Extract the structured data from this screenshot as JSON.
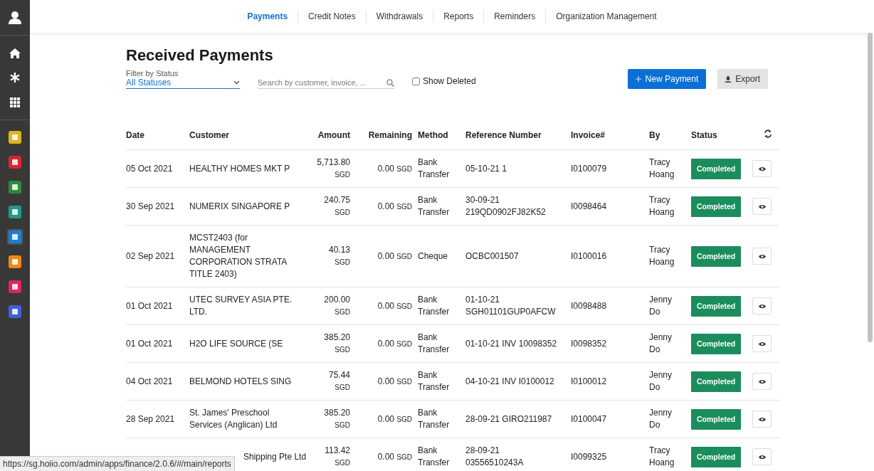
{
  "sidebar": {
    "items": [
      {
        "kind": "user"
      },
      {
        "kind": "home"
      },
      {
        "kind": "asterisk"
      },
      {
        "kind": "grid"
      },
      {
        "kind": "app",
        "color": "#e2b422",
        "selected": false
      },
      {
        "kind": "app",
        "color": "#d8262c",
        "selected": false
      },
      {
        "kind": "app",
        "color": "#2e8b3a",
        "selected": false
      },
      {
        "kind": "app",
        "color": "#1f9a8a",
        "selected": false
      },
      {
        "kind": "app",
        "color": "#1b7fd6",
        "selected": true
      },
      {
        "kind": "app",
        "color": "#ea8a14",
        "selected": false
      },
      {
        "kind": "app",
        "color": "#e0245e",
        "selected": false
      },
      {
        "kind": "app",
        "color": "#3d5fd8",
        "selected": false
      }
    ]
  },
  "tabs": [
    {
      "label": "Payments",
      "selected": true
    },
    {
      "label": "Credit Notes",
      "selected": false
    },
    {
      "label": "Withdrawals",
      "selected": false
    },
    {
      "label": "Reports",
      "selected": false
    },
    {
      "label": "Reminders",
      "selected": false
    },
    {
      "label": "Organization Management",
      "selected": false
    }
  ],
  "page_title": "Received Payments",
  "filter": {
    "label": "Filter by Status",
    "value": "All Statuses"
  },
  "search": {
    "placeholder": "Search by customer, invoice, ..."
  },
  "show_deleted": {
    "label": "Show Deleted",
    "checked": false
  },
  "buttons": [
    {
      "kind": "primary",
      "label": "New Payment"
    },
    {
      "kind": "export",
      "label": "Export"
    }
  ],
  "table": {
    "columns": [
      "Date",
      "Customer",
      "Amount",
      "Remaining",
      "Method",
      "Reference Number",
      "Invoice#",
      "By",
      "Status"
    ],
    "rows": [
      {
        "date": "05 Oct 2021",
        "customer": "HEALTHY HOMES MKT P",
        "amount": "5,713.80",
        "amount_currency": "SGD",
        "remaining": "0.00",
        "remaining_currency": "SGD",
        "method": "Bank Transfer",
        "reference": "05-10-21 1",
        "invoice": "I0100079",
        "by": "Tracy Hoang",
        "status": "Completed"
      },
      {
        "date": "30 Sep 2021",
        "customer": "NUMERIX SINGAPORE P",
        "amount": "240.75",
        "amount_currency": "SGD",
        "remaining": "0.00",
        "remaining_currency": "SGD",
        "method": "Bank Transfer",
        "reference": "30-09-21 219QD0902FJ82K52",
        "invoice": "I0098464",
        "by": "Tracy Hoang",
        "status": "Completed"
      },
      {
        "date": "02 Sep 2021",
        "customer": "MCST2403 (for MANAGEMENT CORPORATION STRATA TITLE 2403)",
        "amount": "40.13",
        "amount_currency": "SGD",
        "remaining": "0.00",
        "remaining_currency": "SGD",
        "method": "Cheque",
        "reference": "OCBC001507",
        "invoice": "I0100016",
        "by": "Tracy Hoang",
        "status": "Completed"
      },
      {
        "date": "01 Oct 2021",
        "customer": "UTEC SURVEY ASIA PTE. LTD.",
        "amount": "200.00",
        "amount_currency": "SGD",
        "remaining": "0.00",
        "remaining_currency": "SGD",
        "method": "Bank Transfer",
        "reference": "01-10-21 SGH01101GUP0AFCW",
        "invoice": "I0098488",
        "by": "Jenny Do",
        "status": "Completed"
      },
      {
        "date": "01 Oct 2021",
        "customer": "H2O LIFE SOURCE (SE",
        "amount": "385.20",
        "amount_currency": "SGD",
        "remaining": "0.00",
        "remaining_currency": "SGD",
        "method": "Bank Transfer",
        "reference": "01-10-21 INV 10098352",
        "invoice": "I0098352",
        "by": "Jenny Do",
        "status": "Completed"
      },
      {
        "date": "04 Oct 2021",
        "customer": "BELMOND HOTELS SING",
        "amount": "75.44",
        "amount_currency": "SGD",
        "remaining": "0.00",
        "remaining_currency": "SGD",
        "method": "Bank Transfer",
        "reference": "04-10-21 INV I0100012",
        "invoice": "I0100012",
        "by": "Jenny Do",
        "status": "Completed"
      },
      {
        "date": "28 Sep 2021",
        "customer": "St. James' Preschool Services (Anglican) Ltd",
        "amount": "385.20",
        "amount_currency": "SGD",
        "remaining": "0.00",
        "remaining_currency": "SGD",
        "method": "Bank Transfer",
        "reference": "28-09-21 GIRO211987",
        "invoice": "I0100047",
        "by": "Jenny Do",
        "status": "Completed"
      },
      {
        "customer": "Shipping Pte Ltd",
        "amount": "113.42",
        "amount_currency": "SGD",
        "remaining": "0.00",
        "remaining_currency": "SGD",
        "method": "Bank Transfer",
        "reference": "28-09-21 03556510243A",
        "invoice": "I0099325",
        "by": "Tracy Hoang",
        "status": "Completed"
      }
    ]
  },
  "status_bar": {
    "url": "https://sg.hoiio.com/admin/apps/finance/2.0.6/#/main/reports"
  }
}
